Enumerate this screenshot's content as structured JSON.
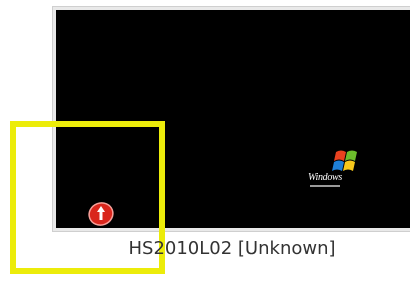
{
  "vm": {
    "name_label": "HS2010L02 [Unknown]",
    "os_logo_text": "Windows",
    "status_icon": "vm-status-alert-icon",
    "logo_icon": "windows-xp-logo-icon"
  },
  "highlight": {
    "color": "#ecec0a"
  },
  "colors": {
    "screen_background": "#000000",
    "status_icon_red": "#d9261c"
  }
}
